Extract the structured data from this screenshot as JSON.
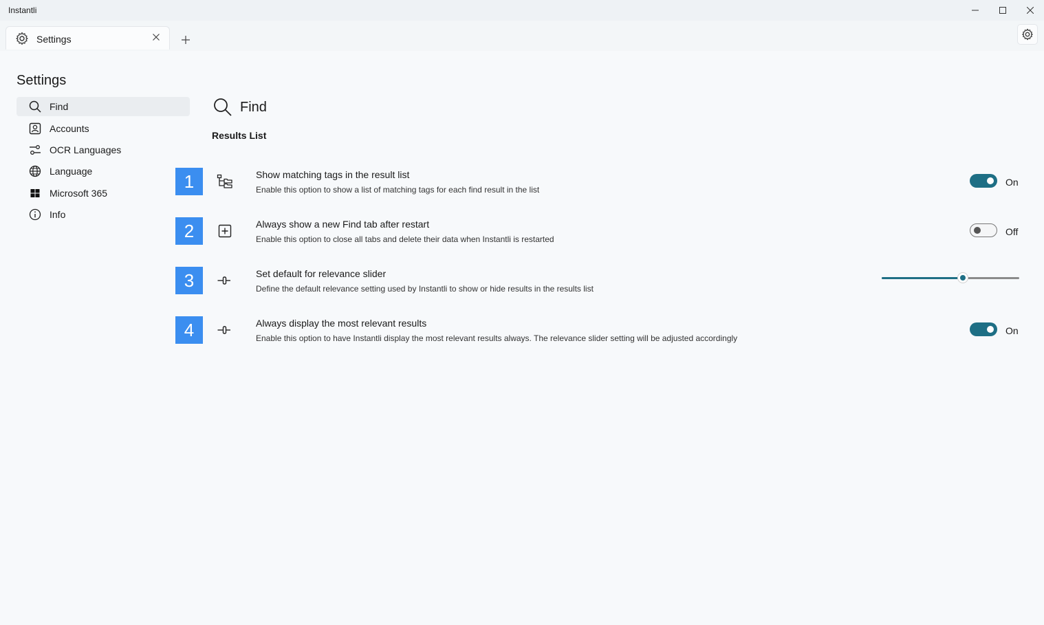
{
  "window": {
    "title": "Instantli"
  },
  "tabs": [
    {
      "label": "Settings"
    }
  ],
  "sidebar": {
    "title": "Settings",
    "items": [
      {
        "label": "Find",
        "icon": "search-icon",
        "selected": true
      },
      {
        "label": "Accounts",
        "icon": "account-icon"
      },
      {
        "label": "OCR Languages",
        "icon": "ocr-languages-icon"
      },
      {
        "label": "Language",
        "icon": "globe-icon"
      },
      {
        "label": "Microsoft 365",
        "icon": "microsoft-365-icon"
      },
      {
        "label": "Info",
        "icon": "info-icon"
      }
    ]
  },
  "main": {
    "heading": "Find",
    "section": "Results List",
    "settings": [
      {
        "badge": "1",
        "icon": "tags-tree-icon",
        "title": "Show matching tags in the result list",
        "description": "Enable this option to show a list of matching tags for each find result in the list",
        "control": "toggle",
        "state": "On"
      },
      {
        "badge": "2",
        "icon": "add-tab-icon",
        "title": "Always show a new Find tab after restart",
        "description": "Enable this option to close all tabs and delete their data when Instantli is restarted",
        "control": "toggle",
        "state": "Off"
      },
      {
        "badge": "3",
        "icon": "slider-icon",
        "title": "Set default for relevance slider",
        "description": "Define the default relevance setting used by Instantli to show or hide results in the results list",
        "control": "slider",
        "value": 0.59
      },
      {
        "badge": "4",
        "icon": "slider-icon",
        "title": "Always display the most relevant results",
        "description": "Enable this option to have Instantli display the most relevant results always. The relevance slider setting will be adjusted accordingly",
        "control": "toggle",
        "state": "On"
      }
    ]
  },
  "colors": {
    "accent": "#1e6f85",
    "badge": "#3b8ef0"
  }
}
